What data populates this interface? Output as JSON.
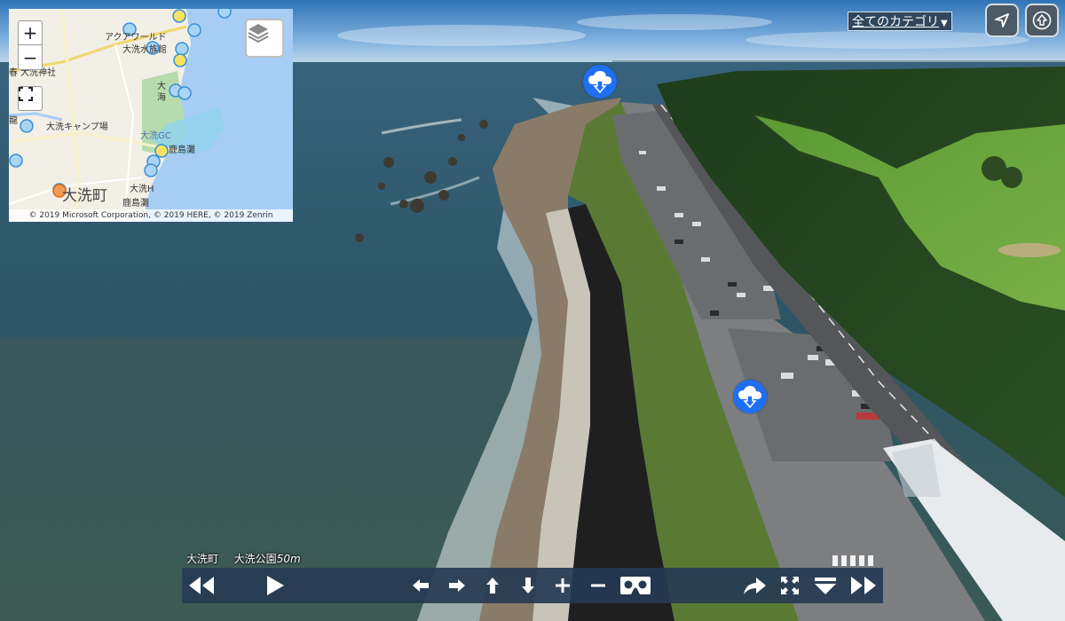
{
  "minimap": {
    "labels": {
      "aquaworld": "アクアワールド",
      "oarai_suizokukan": "大洗水族館",
      "shrine": "大洗神社",
      "campsite": "大洗キャンプ場",
      "golf": "大洗GC",
      "sea_1": "海",
      "sea_2": "大",
      "beach_kashimanada": "鹿島灘",
      "oarai_h": "大洗H",
      "town": "大洗町",
      "kashimanada_2": "鹿島灘",
      "left_1": "春",
      "left_2": "龍"
    },
    "copyright": "© 2019 Microsoft Corporation, © 2019 HERE, © 2019 Zenrin",
    "zoom_in": "+",
    "zoom_out": "−"
  },
  "header": {
    "category_label": "全てのカテゴリ",
    "category_caret": "▼"
  },
  "caption": {
    "place": "大洗町",
    "spot": "大洗公園",
    "altitude": "50m"
  },
  "icons": {
    "locate": "navigation-arrow-icon",
    "top": "up-arrow-circle-icon",
    "hotspot": "cloud-download-icon",
    "layers": "layers-icon"
  }
}
